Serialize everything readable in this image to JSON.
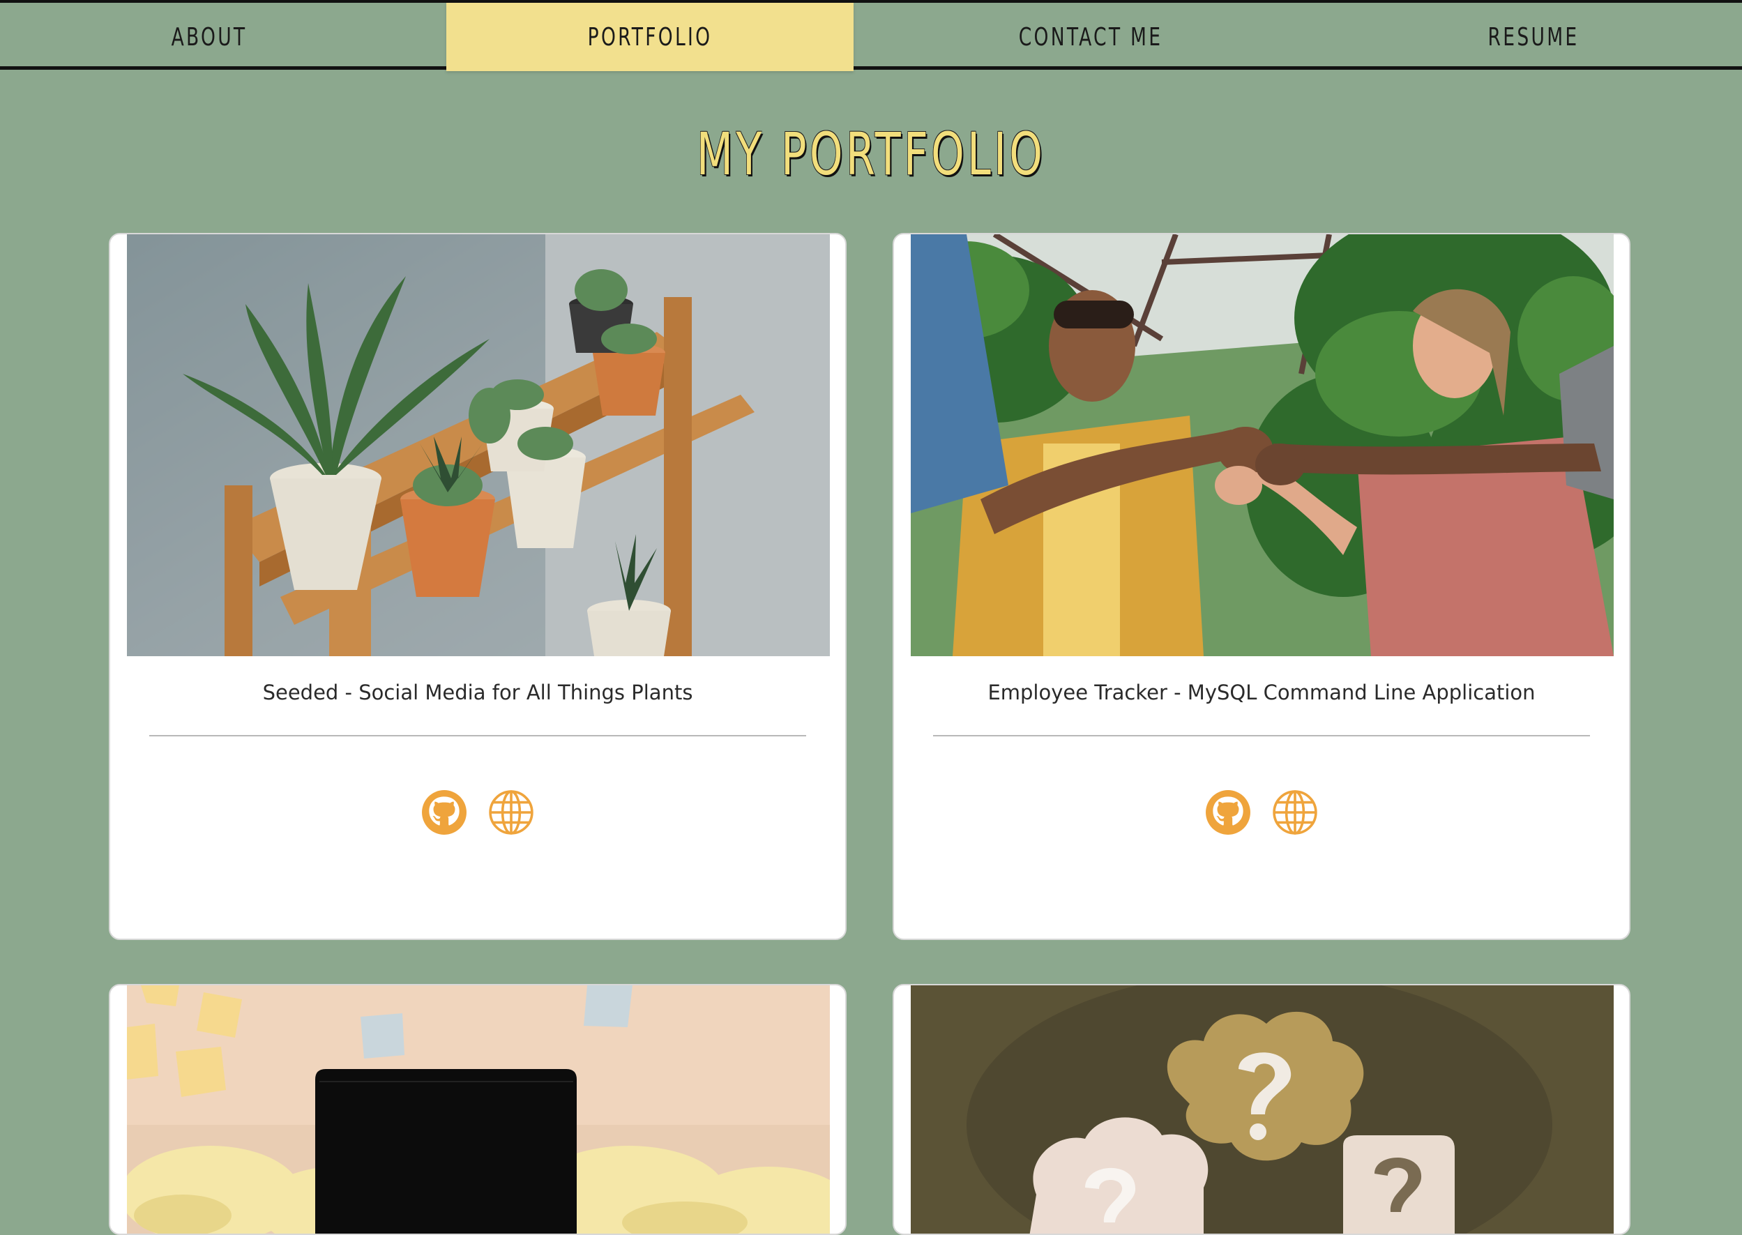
{
  "nav": {
    "items": [
      {
        "label": "ABOUT"
      },
      {
        "label": "PORTFOLIO",
        "active": true
      },
      {
        "label": "CONTACT ME"
      },
      {
        "label": "RESUME"
      }
    ]
  },
  "page_title": "MY PORTFOLIO",
  "colors": {
    "background": "#8ca88e",
    "nav_active": "#f2e08e",
    "title": "#f2de7c",
    "icon_accent": "#efa43c"
  },
  "projects": [
    {
      "title": "Seeded - Social Media for All Things Plants",
      "image": "potted-plants-on-wooden-shelf",
      "icons": [
        "github-icon",
        "globe-icon"
      ]
    },
    {
      "title": "Employee Tracker - MySQL Command Line Application",
      "image": "people-fist-bump-in-greenhouse",
      "icons": [
        "github-icon",
        "globe-icon"
      ]
    },
    {
      "title": "",
      "image": "laptop-with-crumpled-paper"
    },
    {
      "title": "",
      "image": "question-mark-speech-bubbles"
    }
  ]
}
